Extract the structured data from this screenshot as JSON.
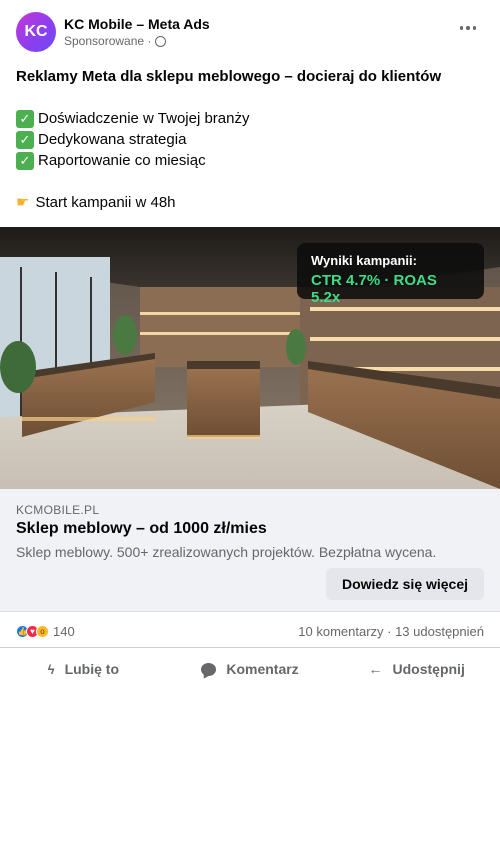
{
  "post": {
    "avatar_initials": "KC",
    "page_name": "KC Mobile – Meta Ads",
    "sponsored_label": "Sponsorowane ·",
    "headline": "Reklamy Meta dla sklepu meblowego – docieraj do klientów",
    "benefits": [
      "Doświadczenie w Twojej branży",
      "Dedykowana strategia",
      "Raportowanie co miesiąc"
    ],
    "cta_line": "Start kampanii w 48h"
  },
  "image_overlay": {
    "title": "Wyniki kampanii:",
    "value": "CTR 4.7% · ROAS 5.2x"
  },
  "link_card": {
    "domain": "KCMOBILE.PL",
    "title": "Sklep meblowy – od 1000 zł/mies",
    "description": "Sklep meblowy. 500+ zrealizowanych projektów. Bezpłatna wycena.",
    "button_label": "Dowiedz się więcej"
  },
  "stats": {
    "reaction_count": "140",
    "comments_shares": "10 komentarzy · 13 udostępnień"
  },
  "actions": {
    "like": "Lubię to",
    "comment": "Komentarz",
    "share": "Udostępnij"
  },
  "icons": {
    "benefit_icon": "check-mark-button",
    "cta_icon": "pointing-hand",
    "reactions": [
      "like",
      "love",
      "wow"
    ]
  },
  "colors": {
    "accent_green": "#3ddc84",
    "avatar_gradient_start": "#c238d6",
    "avatar_gradient_end": "#6a4cf5",
    "card_background": "#f0f2f5",
    "button_background": "#e4e6eb"
  }
}
